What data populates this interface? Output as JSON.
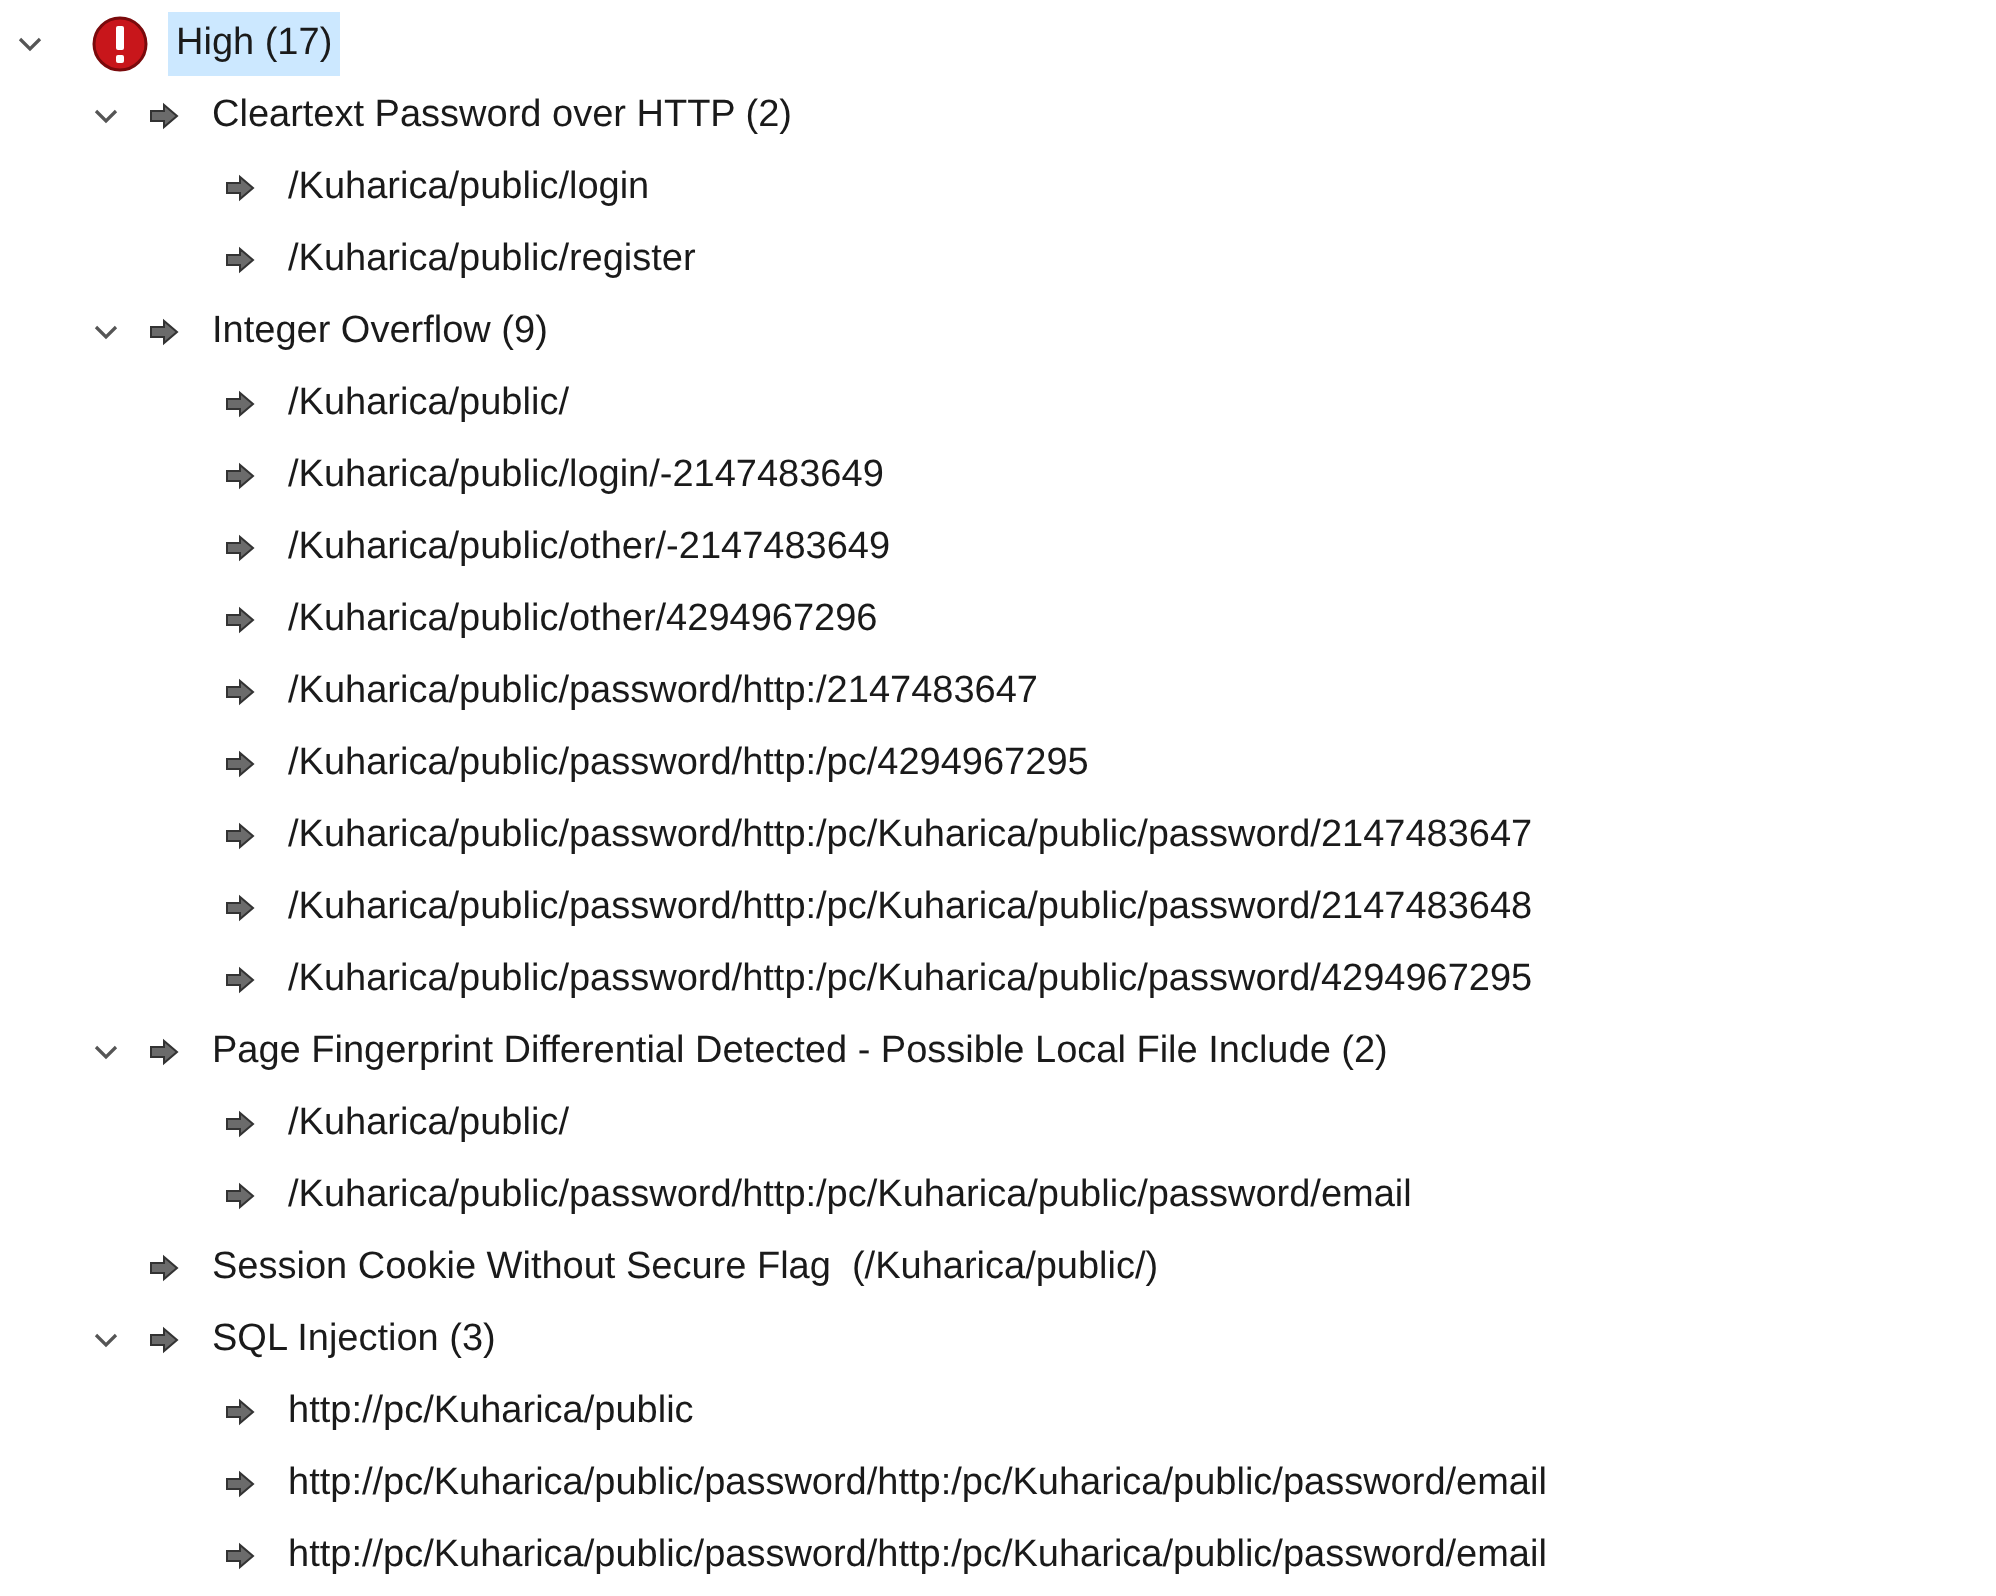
{
  "tree": [
    {
      "label": "High (17)",
      "kind": "severity",
      "selected": true,
      "expanded": true,
      "children": [
        {
          "label": "Cleartext Password over HTTP (2)",
          "kind": "finding",
          "selected": false,
          "expanded": true,
          "children": [
            {
              "label": "/Kuharica/public/login",
              "kind": "finding",
              "selected": false
            },
            {
              "label": "/Kuharica/public/register",
              "kind": "finding",
              "selected": false
            }
          ]
        },
        {
          "label": "Integer Overflow (9)",
          "kind": "finding",
          "selected": false,
          "expanded": true,
          "children": [
            {
              "label": "/Kuharica/public/",
              "kind": "finding",
              "selected": false
            },
            {
              "label": "/Kuharica/public/login/-2147483649",
              "kind": "finding",
              "selected": false
            },
            {
              "label": "/Kuharica/public/other/-2147483649",
              "kind": "finding",
              "selected": false
            },
            {
              "label": "/Kuharica/public/other/4294967296",
              "kind": "finding",
              "selected": false
            },
            {
              "label": "/Kuharica/public/password/http:/2147483647",
              "kind": "finding",
              "selected": false
            },
            {
              "label": "/Kuharica/public/password/http:/pc/4294967295",
              "kind": "finding",
              "selected": false
            },
            {
              "label": "/Kuharica/public/password/http:/pc/Kuharica/public/password/2147483647",
              "kind": "finding",
              "selected": false
            },
            {
              "label": "/Kuharica/public/password/http:/pc/Kuharica/public/password/2147483648",
              "kind": "finding",
              "selected": false
            },
            {
              "label": "/Kuharica/public/password/http:/pc/Kuharica/public/password/4294967295",
              "kind": "finding",
              "selected": false
            }
          ]
        },
        {
          "label": "Page Fingerprint Differential Detected - Possible Local File Include (2)",
          "kind": "finding",
          "selected": false,
          "expanded": true,
          "children": [
            {
              "label": "/Kuharica/public/",
              "kind": "finding",
              "selected": false
            },
            {
              "label": "/Kuharica/public/password/http:/pc/Kuharica/public/password/email",
              "kind": "finding",
              "selected": false
            }
          ]
        },
        {
          "label": "Session Cookie Without Secure Flag  (/Kuharica/public/)",
          "kind": "finding",
          "selected": false
        },
        {
          "label": "SQL Injection (3)",
          "kind": "finding",
          "selected": false,
          "expanded": true,
          "children": [
            {
              "label": "http://pc/Kuharica/public",
              "kind": "finding",
              "selected": false
            },
            {
              "label": "http://pc/Kuharica/public/password/http:/pc/Kuharica/public/password/email",
              "kind": "finding",
              "selected": false
            },
            {
              "label": "http://pc/Kuharica/public/password/http:/pc/Kuharica/public/password/email",
              "kind": "finding",
              "selected": false
            }
          ]
        }
      ]
    }
  ]
}
